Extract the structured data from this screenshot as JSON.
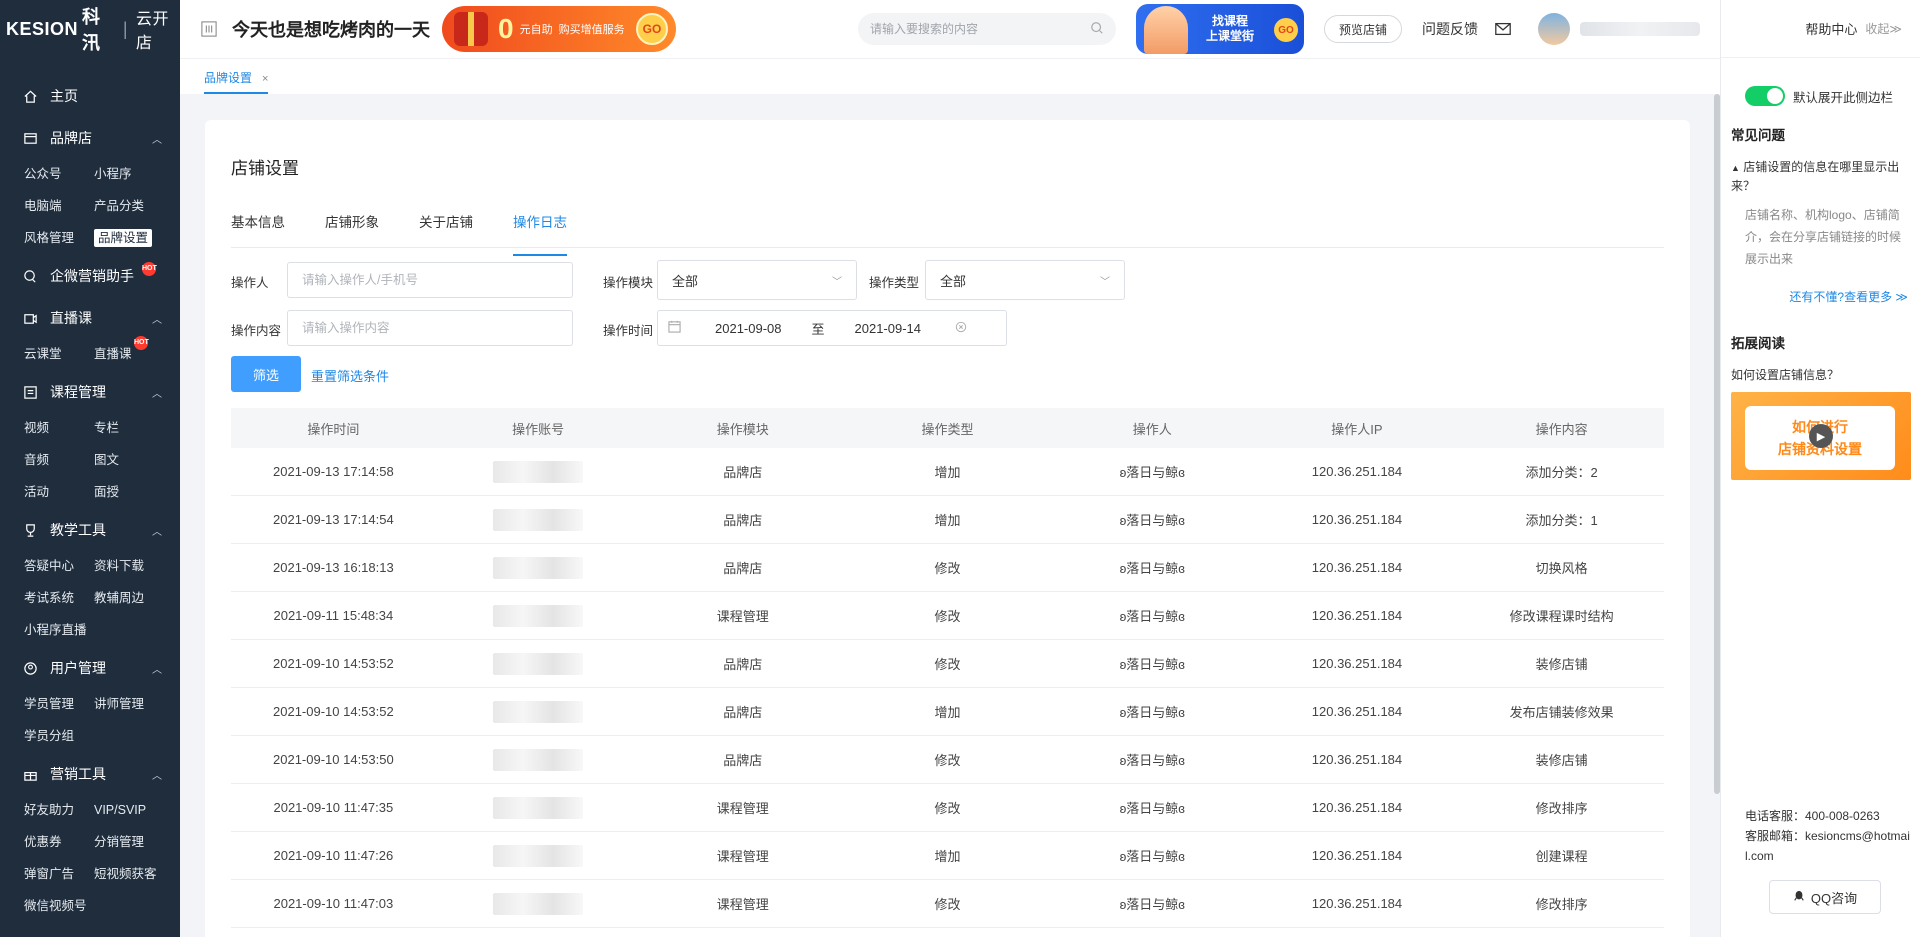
{
  "brand": {
    "logo": "KESION",
    "logo_cn": "科汛",
    "store": "云开店"
  },
  "sidebar": {
    "home": "主页",
    "groups": [
      {
        "title": "品牌店",
        "items": [
          "公众号",
          "小程序",
          "电脑端",
          "产品分类",
          "风格管理",
          "品牌设置"
        ],
        "active": "品牌设置"
      },
      {
        "title": "企微营销助手",
        "hot": "HOT",
        "items": []
      },
      {
        "title": "直播课",
        "items": [
          "云课堂",
          "直播课"
        ],
        "hot_item": "HOT"
      },
      {
        "title": "课程管理",
        "items": [
          "视频",
          "专栏",
          "音频",
          "图文",
          "活动",
          "面授"
        ]
      },
      {
        "title": "教学工具",
        "items": [
          "答疑中心",
          "资料下载",
          "考试系统",
          "教辅周边",
          "小程序直播"
        ]
      },
      {
        "title": "用户管理",
        "items": [
          "学员管理",
          "讲师管理",
          "学员分组"
        ]
      },
      {
        "title": "营销工具",
        "items": [
          "好友助力",
          "VIP/SVIP",
          "优惠券",
          "分销管理",
          "弹窗广告",
          "短视频获客",
          "微信视频号"
        ]
      }
    ]
  },
  "topbar": {
    "slogan": "今天也是想吃烤肉的一天",
    "promo": {
      "zero": "0",
      "text1": "元自助",
      "text2": "购买增值服务",
      "go": "GO"
    },
    "search_placeholder": "请输入要搜索的内容",
    "course_banner": {
      "line1": "找课程",
      "line2": "上课堂街",
      "go": "GO"
    },
    "preview": "预览店铺",
    "feedback": "问题反馈"
  },
  "tabstrip": {
    "tab": "品牌设置",
    "close": "×"
  },
  "card": {
    "title": "店铺设置",
    "tabs": [
      "基本信息",
      "店铺形象",
      "关于店铺",
      "操作日志"
    ],
    "active_tab": "操作日志",
    "filters": {
      "operator_label": "操作人",
      "operator_placeholder": "请输入操作人/手机号",
      "module_label": "操作模块",
      "module_value": "全部",
      "type_label": "操作类型",
      "type_value": "全部",
      "content_label": "操作内容",
      "content_placeholder": "请输入操作内容",
      "time_label": "操作时间",
      "date_start": "2021-09-08",
      "date_sep": "至",
      "date_end": "2021-09-14",
      "filter_btn": "筛选",
      "reset": "重置筛选条件"
    },
    "table": {
      "headers": [
        "操作时间",
        "操作账号",
        "操作模块",
        "操作类型",
        "操作人",
        "操作人IP",
        "操作内容"
      ],
      "rows": [
        [
          "2021-09-13 17:14:58",
          "",
          "品牌店",
          "增加",
          "ʚ落日与鲸ɞ",
          "120.36.251.184",
          "添加分类：2"
        ],
        [
          "2021-09-13 17:14:54",
          "",
          "品牌店",
          "增加",
          "ʚ落日与鲸ɞ",
          "120.36.251.184",
          "添加分类：1"
        ],
        [
          "2021-09-13 16:18:13",
          "",
          "品牌店",
          "修改",
          "ʚ落日与鲸ɞ",
          "120.36.251.184",
          "切换风格"
        ],
        [
          "2021-09-11 15:48:34",
          "",
          "课程管理",
          "修改",
          "ʚ落日与鲸ɞ",
          "120.36.251.184",
          "修改课程课时结构"
        ],
        [
          "2021-09-10 14:53:52",
          "",
          "品牌店",
          "修改",
          "ʚ落日与鲸ɞ",
          "120.36.251.184",
          "装修店铺"
        ],
        [
          "2021-09-10 14:53:52",
          "",
          "品牌店",
          "增加",
          "ʚ落日与鲸ɞ",
          "120.36.251.184",
          "发布店铺装修效果"
        ],
        [
          "2021-09-10 14:53:50",
          "",
          "品牌店",
          "修改",
          "ʚ落日与鲸ɞ",
          "120.36.251.184",
          "装修店铺"
        ],
        [
          "2021-09-10 11:47:35",
          "",
          "课程管理",
          "修改",
          "ʚ落日与鲸ɞ",
          "120.36.251.184",
          "修改排序"
        ],
        [
          "2021-09-10 11:47:26",
          "",
          "课程管理",
          "增加",
          "ʚ落日与鲸ɞ",
          "120.36.251.184",
          "创建课程"
        ],
        [
          "2021-09-10 11:47:03",
          "",
          "课程管理",
          "修改",
          "ʚ落日与鲸ɞ",
          "120.36.251.184",
          "修改排序"
        ]
      ]
    }
  },
  "rpanel": {
    "help": "帮助中心",
    "collapse": "收起≫",
    "toggle_label": "默认展开此侧边栏",
    "faq_title": "常见问题",
    "faq_q": "店铺设置的信息在哪里显示出来？",
    "faq_a": "店铺名称、机构logo、店铺简介，会在分享店铺链接的时候展示出来",
    "more": "还有不懂?查看更多 ≫",
    "ext_title": "拓展阅读",
    "ext_q": "如何设置店铺信息？",
    "ext_banner_line1": "如何进行",
    "ext_banner_line2": "店铺资料设置",
    "phone": "电话客服：400-008-0263",
    "email": "客服邮箱：kesioncms@hotmail.com",
    "qq": "QQ咨询"
  },
  "colors": {
    "sidebar_bg": "#1f2d3d",
    "accent": "#1e88e5",
    "primary_btn": "#409eff",
    "switch_on": "#13ce66"
  }
}
